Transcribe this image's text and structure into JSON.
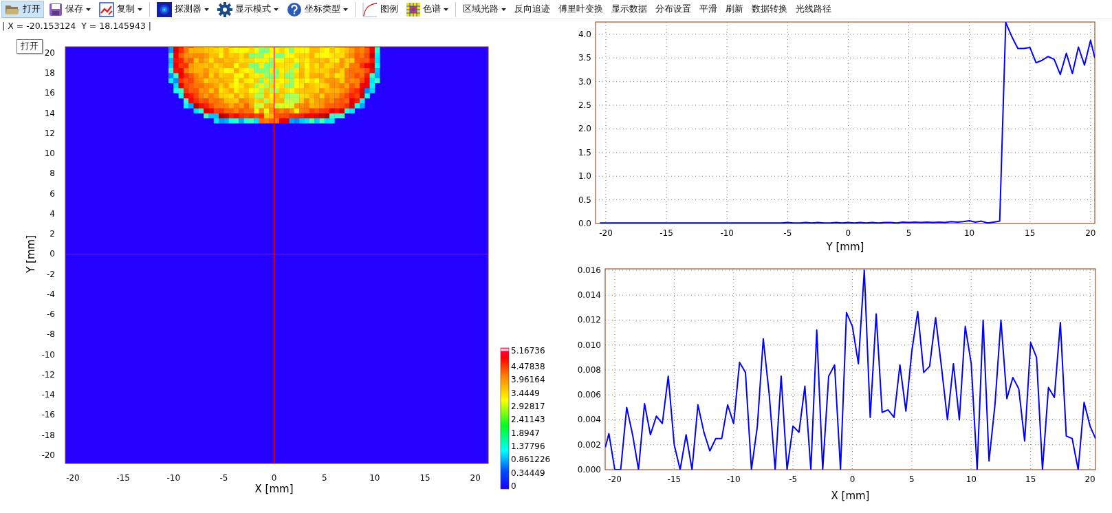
{
  "toolbar": {
    "items": [
      {
        "kind": "button",
        "label": "打开",
        "dropdown": false,
        "selected": true
      },
      {
        "kind": "button",
        "label": "保存",
        "dropdown": true,
        "selected": false
      },
      {
        "kind": "button",
        "label": "复制",
        "dropdown": true,
        "selected": false
      },
      {
        "kind": "separator"
      },
      {
        "kind": "button",
        "label": "探测器",
        "dropdown": true,
        "selected": false
      },
      {
        "kind": "button",
        "label": "显示模式",
        "dropdown": true,
        "selected": false
      },
      {
        "kind": "button",
        "label": "坐标类型",
        "dropdown": true,
        "selected": false
      },
      {
        "kind": "separator"
      },
      {
        "kind": "button",
        "label": "图例",
        "dropdown": false,
        "selected": false
      },
      {
        "kind": "button",
        "label": "色谱",
        "dropdown": true,
        "selected": false
      },
      {
        "kind": "separator"
      },
      {
        "kind": "button",
        "label": "区域光路",
        "dropdown": true,
        "selected": false
      },
      {
        "kind": "button",
        "label": "反向追迹",
        "dropdown": false,
        "selected": false
      },
      {
        "kind": "button",
        "label": "傅里叶变换",
        "dropdown": false,
        "selected": false
      },
      {
        "kind": "button",
        "label": "显示数据",
        "dropdown": false,
        "selected": false
      },
      {
        "kind": "button",
        "label": "分布设置",
        "dropdown": false,
        "selected": false
      },
      {
        "kind": "button",
        "label": "平滑",
        "dropdown": false,
        "selected": false
      },
      {
        "kind": "button",
        "label": "刷新",
        "dropdown": false,
        "selected": false
      },
      {
        "kind": "button",
        "label": "数据转换",
        "dropdown": false,
        "selected": false
      },
      {
        "kind": "button",
        "label": "光线路径",
        "dropdown": false,
        "selected": false
      }
    ]
  },
  "status_line": "| X = -20.153124  Y = 18.145943 |",
  "tooltip": {
    "text": "打开"
  },
  "intensity_map": {
    "xlabel": "X [mm]",
    "ylabel": "Y [mm]",
    "xticks": [
      "-20",
      "-15",
      "-10",
      "-5",
      "0",
      "5",
      "10",
      "15",
      "20"
    ],
    "yticks": [
      "20",
      "18",
      "16",
      "14",
      "12",
      "10",
      "8",
      "6",
      "4",
      "2",
      "0",
      "-2",
      "-4",
      "-6",
      "-8",
      "-10",
      "-12",
      "-14",
      "-16",
      "-18",
      "-20"
    ],
    "colorbar_labels": [
      "5.16736",
      "4.47838",
      "3.96164",
      "3.4449",
      "2.92817",
      "2.41143",
      "1.8947",
      "1.37796",
      "0.861226",
      "0.34449",
      "0"
    ]
  },
  "profiles": [
    {
      "chart_data": {
        "type": "line",
        "grid": true,
        "xlabel": "Y [mm]",
        "xlim": [
          -20.85,
          20.35
        ],
        "ylim": [
          0,
          4.26
        ],
        "xticks": [
          -20,
          -15,
          -10,
          -5,
          0,
          5,
          10,
          15,
          20
        ],
        "yticks": [
          {
            "value": 0,
            "label": "0.0"
          },
          {
            "value": 0.5,
            "label": "0.5"
          },
          {
            "value": 1,
            "label": "1.0"
          },
          {
            "value": 1.5,
            "label": "1.5"
          },
          {
            "value": 2,
            "label": "2.0"
          },
          {
            "value": 2.5,
            "label": "2.5"
          },
          {
            "value": 3,
            "label": "3.0"
          },
          {
            "value": 3.5,
            "label": "3.5"
          },
          {
            "value": 4,
            "label": "4.0"
          }
        ],
        "x": [
          -20.5,
          -20,
          -19.5,
          -19,
          -18.5,
          -18,
          -17.5,
          -17,
          -16.5,
          -16,
          -15.5,
          -15,
          -14.5,
          -14,
          -13.5,
          -13,
          -12.5,
          -12,
          -11.5,
          -11,
          -10.5,
          -10,
          -9.5,
          -9,
          -8.5,
          -8,
          -7.5,
          -7,
          -6.5,
          -6,
          -5.5,
          -5,
          -4.5,
          -4,
          -3.5,
          -3,
          -2.5,
          -2,
          -1.5,
          -1,
          -0.5,
          0,
          0.5,
          1,
          1.5,
          2,
          2.5,
          3,
          3.5,
          4,
          4.5,
          5,
          5.5,
          6,
          6.5,
          7,
          7.5,
          8,
          8.5,
          9,
          9.5,
          10,
          10.5,
          11,
          11.5,
          12,
          12.5,
          13,
          13.5,
          14,
          14.5,
          15,
          15.5,
          16,
          16.5,
          17,
          17.5,
          18,
          18.5,
          19,
          19.5,
          20,
          20.35
        ],
        "series": [
          {
            "color": "#0000ff",
            "values": [
              0.01,
              0.01,
              0.01,
              0.01,
              0.01,
              0.01,
              0.01,
              0.01,
              0.01,
              0.01,
              0.01,
              0.01,
              0.01,
              0.01,
              0.01,
              0.01,
              0.01,
              0.01,
              0.01,
              0.01,
              0.01,
              0.01,
              0.01,
              0.01,
              0.01,
              0.01,
              0.01,
              0.01,
              0.01,
              0.01,
              0.01,
              0.02,
              0.01,
              0.01,
              0.02,
              0.01,
              0.02,
              0.01,
              0.01,
              0.02,
              0.01,
              0.02,
              0.01,
              0.02,
              0.01,
              0.02,
              0.01,
              0.02,
              0.02,
              0.01,
              0.03,
              0.02,
              0.03,
              0.02,
              0.03,
              0.02,
              0.03,
              0.02,
              0.04,
              0.03,
              0.04,
              0.06,
              0.03,
              0.05,
              0.01,
              0.03,
              0.05,
              4.25,
              3.95,
              3.7,
              3.7,
              3.72,
              3.4,
              3.45,
              3.53,
              3.47,
              3.15,
              3.6,
              3.17,
              3.73,
              3.35,
              3.87,
              3.5
            ]
          }
        ]
      }
    },
    {
      "chart_data": {
        "type": "line",
        "grid": true,
        "xlabel": "X [mm]",
        "xlim": [
          -20.81,
          20.46
        ],
        "ylim": [
          0,
          0.01611
        ],
        "xticks": [
          -20,
          -15,
          -10,
          -5,
          0,
          5,
          10,
          15,
          20
        ],
        "yticks": [
          {
            "value": 0,
            "label": "0.000"
          },
          {
            "value": 0.002,
            "label": "0.002"
          },
          {
            "value": 0.004,
            "label": "0.004"
          },
          {
            "value": 0.006,
            "label": "0.006"
          },
          {
            "value": 0.008,
            "label": "0.008"
          },
          {
            "value": 0.01,
            "label": "0.010"
          },
          {
            "value": 0.012,
            "label": "0.012"
          },
          {
            "value": 0.014,
            "label": "0.014"
          },
          {
            "value": 0.016,
            "label": "0.016"
          }
        ],
        "x": [
          -20.8,
          -20.5,
          -20,
          -19.5,
          -19,
          -18.5,
          -18,
          -17.5,
          -17,
          -16.5,
          -16,
          -15.5,
          -15,
          -14.5,
          -14,
          -13.5,
          -13,
          -12.5,
          -12,
          -11.5,
          -11,
          -10.5,
          -10,
          -9.5,
          -9,
          -8.5,
          -8,
          -7.5,
          -7,
          -6.5,
          -6,
          -5.5,
          -5,
          -4.5,
          -4,
          -3.5,
          -3,
          -2.5,
          -2,
          -1.5,
          -1,
          -0.5,
          0,
          0.5,
          1,
          1.5,
          2,
          2.5,
          3,
          3.5,
          4,
          4.5,
          5,
          5.5,
          6,
          6.5,
          7,
          7.5,
          8,
          8.5,
          9,
          9.5,
          10,
          10.5,
          11,
          11.5,
          12,
          12.5,
          13,
          13.5,
          14,
          14.5,
          15,
          15.5,
          16,
          16.5,
          17,
          17.5,
          18,
          18.5,
          19,
          19.5,
          20,
          20.46
        ],
        "series": [
          {
            "color": "#0000ff",
            "values": [
              0.0018,
              0.0029,
              0,
              0,
              0.005,
              0.0028,
              0,
              0.0053,
              0.0028,
              0.0043,
              0.0037,
              0.0075,
              0.002,
              0,
              0.0028,
              0,
              0.0052,
              0.003,
              0.0015,
              0.0025,
              0.0025,
              0.0052,
              0.0037,
              0.0086,
              0.0078,
              0,
              0.0035,
              0.0105,
              0.006,
              0,
              0.0075,
              0,
              0.0035,
              0.003,
              0.0067,
              0,
              0.0112,
              0,
              0.0075,
              0.0084,
              0,
              0.0126,
              0.0115,
              0.0085,
              0.016,
              0.0042,
              0.0125,
              0.0046,
              0.0048,
              0.0042,
              0.0084,
              0.0047,
              0.0095,
              0.0127,
              0.0078,
              0.0083,
              0.0122,
              0.0082,
              0.004,
              0.0085,
              0.004,
              0.0115,
              0.0085,
              0,
              0.012,
              0.0007,
              0.0052,
              0.012,
              0.0057,
              0.0074,
              0.0065,
              0.0023,
              0.0102,
              0.009,
              0,
              0.0066,
              0.0058,
              0.0118,
              0.0027,
              0.0025,
              0,
              0.0054,
              0.0035,
              0.0025
            ]
          }
        ]
      }
    }
  ]
}
